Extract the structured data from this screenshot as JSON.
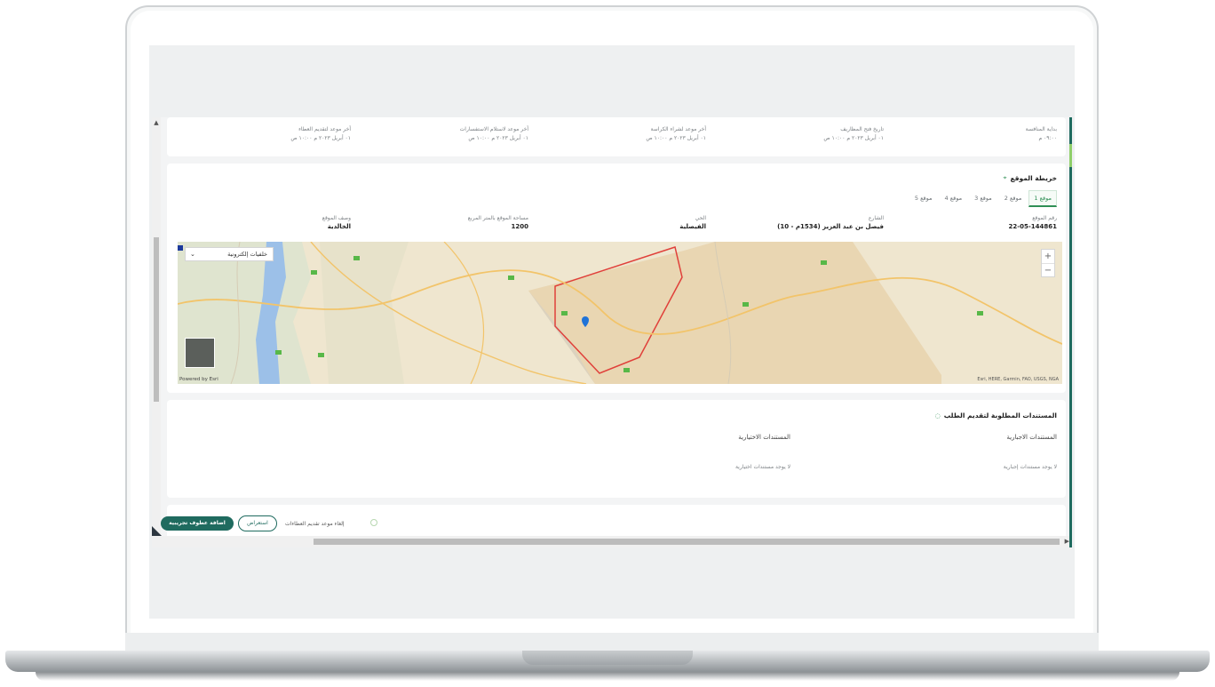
{
  "auction_timeline": {
    "items": [
      {
        "label": "بداية المنافسة",
        "value": "٠٩:٠٠ م"
      },
      {
        "label": "تاريخ فتح المظاريف",
        "value": "٠١ أبريل ٢٠٢٣ م ١٠:٠٠ ص"
      },
      {
        "label": "أخر موعد لشراء الكراسة",
        "value": "٠١ أبريل ٢٠٢٣ م ١٠:٠٠ ص"
      },
      {
        "label": "أخر موعد لاستلام الاستفسارات",
        "value": "٠١ أبريل ٢٠٢٣ م ١٠:٠٠ ص"
      },
      {
        "label": "أخر موعد لتقديم العطاء",
        "value": "٠١ أبريل ٢٠٢٣ م ١٠:٠٠ ص"
      }
    ]
  },
  "site_map": {
    "title": "خريطة الموقع",
    "tabs": [
      "موقع 1",
      "موقع 2",
      "موقع 3",
      "موقع 4",
      "موقع 5"
    ],
    "active_tab": 0,
    "fields": [
      {
        "label": "رقم الموقع",
        "value": "22-05-144861"
      },
      {
        "label": "الشارع",
        "value": "فيصل بن عبد العزيز (1534م - 10)"
      },
      {
        "label": "الحي",
        "value": "الفيصلية"
      },
      {
        "label": "مساحة الموقع بالمتر المربع",
        "value": "1200"
      },
      {
        "label": "وصف الموقع",
        "value": "الخالدية"
      }
    ],
    "map": {
      "basemap_label": "خلفيات إلكترونية",
      "powered_by": "Powered by Esri",
      "attribution": "Esri, HERE, Garmin, FAO, USGS, NGA"
    }
  },
  "required_documents": {
    "title": "المستندات المطلوبة لتقديم الطلب",
    "mandatory_header": "المستندات الاجبارية",
    "optional_header": "المستندات الاختيارية",
    "mandatory_empty": "لا يوجد مستندات إجبارية",
    "optional_empty": "لا يوجد مستندات اختيارية"
  },
  "actions": {
    "primary_label": "اضافة عطوف تجريبية",
    "secondary_label": "استعراض",
    "cancel_label": "إلغاء موعد تقديم العطاءات"
  }
}
